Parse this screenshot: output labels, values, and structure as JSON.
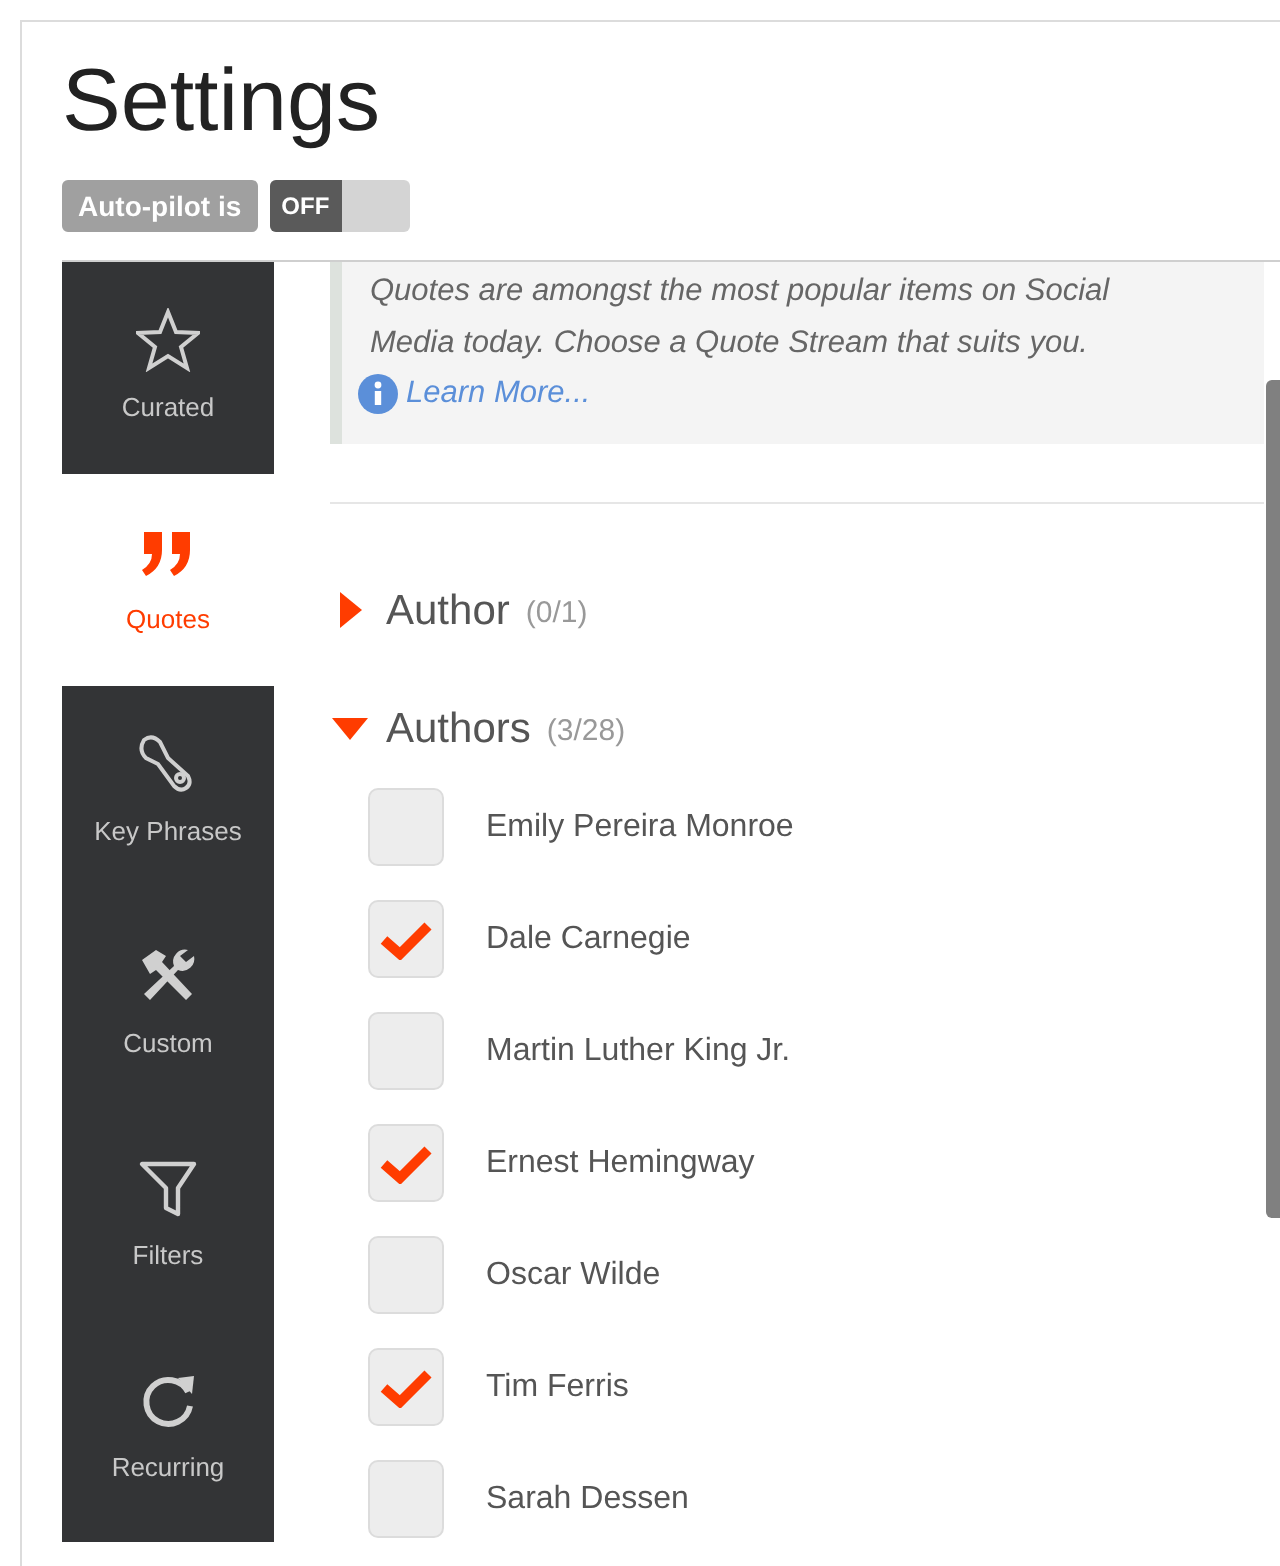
{
  "title": "Settings",
  "autopilot": {
    "label": "Auto-pilot is",
    "toggle_label": "OFF",
    "on": false
  },
  "sidebar": {
    "items": [
      {
        "label": "Curated",
        "kind": "star",
        "selected": false
      },
      {
        "label": "Quotes",
        "kind": "quote",
        "selected": true
      },
      {
        "label": "Key Phrases",
        "kind": "key",
        "selected": false
      },
      {
        "label": "Custom",
        "kind": "tools",
        "selected": false
      },
      {
        "label": "Filters",
        "kind": "funnel",
        "selected": false
      },
      {
        "label": "Recurring",
        "kind": "refresh",
        "selected": false
      }
    ]
  },
  "info": {
    "text": "Quotes are amongst the most popular items on Social Media today. Choose a Quote Stream that suits you.",
    "link": "Learn More..."
  },
  "sections": [
    {
      "title": "Author",
      "count": "(0/1)",
      "expanded": false
    },
    {
      "title": "Authors",
      "count": "(3/28)",
      "expanded": true,
      "items": [
        {
          "label": "Emily Pereira Monroe",
          "checked": false
        },
        {
          "label": "Dale Carnegie",
          "checked": true
        },
        {
          "label": "Martin Luther King Jr.",
          "checked": false
        },
        {
          "label": "Ernest Hemingway",
          "checked": true
        },
        {
          "label": "Oscar Wilde",
          "checked": false
        },
        {
          "label": "Tim Ferris",
          "checked": true
        },
        {
          "label": "Sarah Dessen",
          "checked": false
        }
      ]
    }
  ]
}
